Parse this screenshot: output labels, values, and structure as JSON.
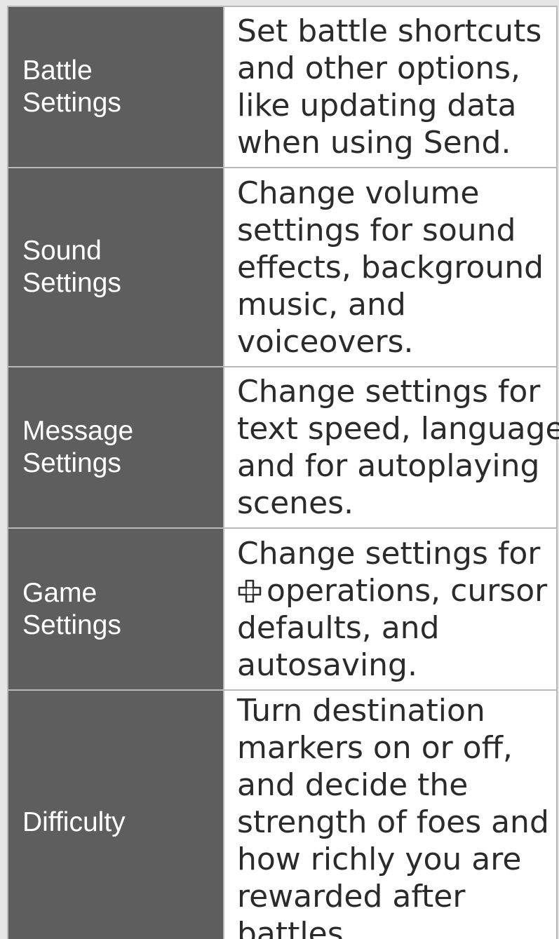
{
  "rows": [
    {
      "label": [
        "Battle",
        "Settings"
      ],
      "desc": [
        "Set battle shortcuts",
        "and other options,",
        "like updating data",
        "when using Send."
      ]
    },
    {
      "label": [
        "Sound",
        "Settings"
      ],
      "desc": [
        "Change volume",
        "settings for sound",
        "effects, background",
        "music, and",
        "voiceovers."
      ]
    },
    {
      "label": [
        "Message",
        "Settings"
      ],
      "desc": [
        "Change settings for",
        "text speed, language",
        "and for autoplaying",
        "scenes."
      ]
    },
    {
      "label": [
        "Game",
        "Settings"
      ],
      "desc": [
        "Change settings for",
        "operations, cursor",
        "defaults, and",
        "autosaving."
      ]
    },
    {
      "label": [
        "Difficulty"
      ],
      "desc": [
        "Turn destination",
        "markers on or off,",
        "and decide the",
        "strength of foes and",
        "how richly you are",
        "rewarded after",
        "battles."
      ]
    }
  ],
  "icons": {
    "game_settings_line2_icon": "dpad-icon"
  }
}
